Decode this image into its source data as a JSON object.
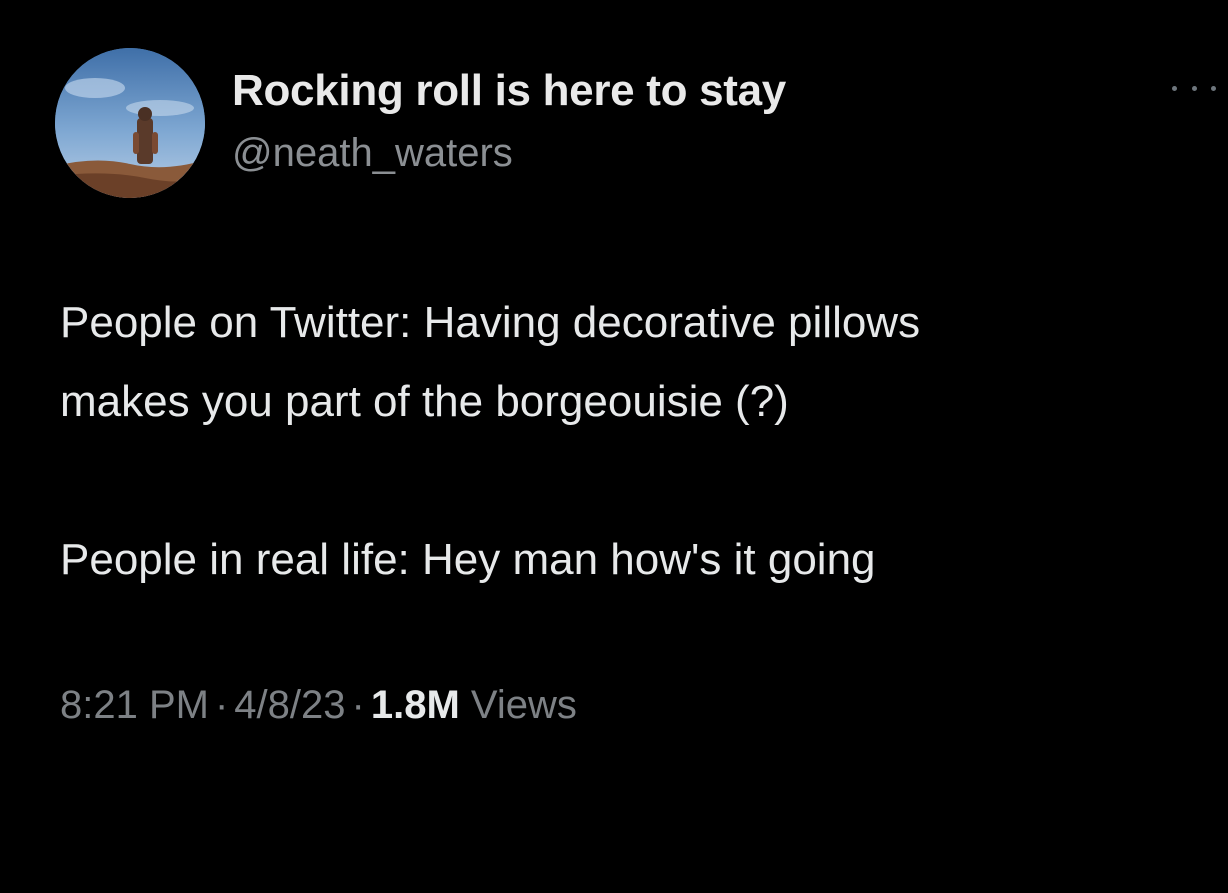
{
  "tweet": {
    "author": {
      "display_name": "Rocking roll is here to stay",
      "handle": "@neath_waters",
      "avatar_icon": "profile-photo"
    },
    "more_icon": "ellipsis-icon",
    "text": {
      "line1": "People on Twitter: Having decorative pillows",
      "line2": "makes you part of the borgeouisie (?)",
      "line3": "People in real life: Hey man how's it going"
    },
    "meta": {
      "time": "8:21 PM",
      "date": "4/8/23",
      "views_count": "1.8M",
      "views_label": "Views",
      "separator": "·"
    }
  },
  "colors": {
    "background": "#000000",
    "primary_text": "#e7e9ea",
    "secondary_text": "#8b8f93"
  }
}
